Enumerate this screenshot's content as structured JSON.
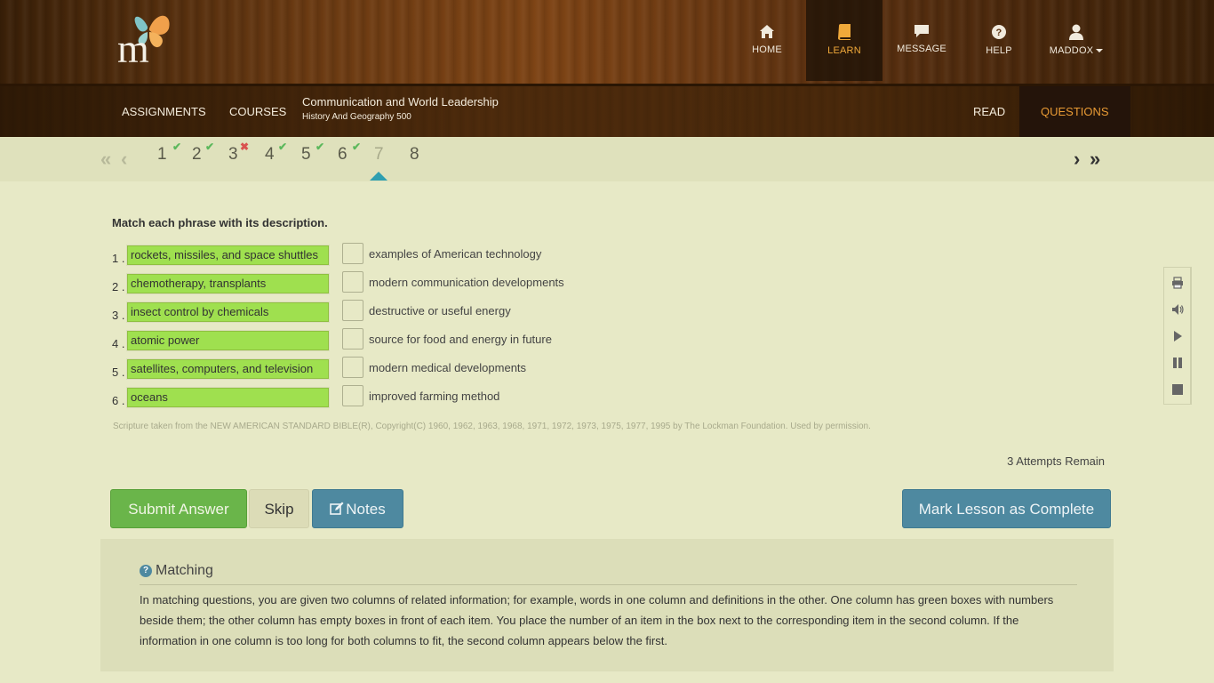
{
  "colors": {
    "accent_orange": "#e89a34",
    "correct_green": "#5cb85c",
    "wrong_red": "#d9534f",
    "phrase_green": "#9fe04f",
    "teal_button": "#4e89a0",
    "submit_green": "#6ab54a"
  },
  "header": {
    "nav": [
      {
        "label": "HOME",
        "icon": "home-icon"
      },
      {
        "label": "LEARN",
        "icon": "book-icon"
      },
      {
        "label": "MESSAGE",
        "icon": "message-icon"
      },
      {
        "label": "HELP",
        "icon": "help-icon"
      },
      {
        "label": "MADDOX",
        "icon": "user-icon"
      }
    ]
  },
  "subnav": {
    "assignments": "ASSIGNMENTS",
    "courses": "COURSES",
    "course_title": "Communication and World Leadership",
    "course_subtitle": "History And Geography 500",
    "read": "READ",
    "questions": "QUESTIONS"
  },
  "pager": {
    "pages": [
      {
        "label": "1",
        "status": "correct"
      },
      {
        "label": "2",
        "status": "correct"
      },
      {
        "label": "3",
        "status": "incorrect"
      },
      {
        "label": "4",
        "status": "correct"
      },
      {
        "label": "5",
        "status": "correct"
      },
      {
        "label": "6",
        "status": "correct"
      },
      {
        "label": "7",
        "status": "current"
      },
      {
        "label": "8",
        "status": "none"
      }
    ],
    "check_mark": "✔",
    "cross_mark": "✖"
  },
  "question": {
    "prompt": "Match each phrase with its description.",
    "items": [
      {
        "num": "1 .",
        "phrase": "rockets, missiles, and space shuttles",
        "answer": "",
        "description": "examples of American technology"
      },
      {
        "num": "2 .",
        "phrase": "chemotherapy, transplants",
        "answer": "",
        "description": "modern communication developments"
      },
      {
        "num": "3 .",
        "phrase": "insect control by chemicals",
        "answer": "",
        "description": "destructive or useful energy"
      },
      {
        "num": "4 .",
        "phrase": "atomic power",
        "answer": "",
        "description": "source for food and energy in future"
      },
      {
        "num": "5 .",
        "phrase": "satellites, computers, and television",
        "answer": "",
        "description": "modern medical developments"
      },
      {
        "num": "6 .",
        "phrase": "oceans",
        "answer": "",
        "description": "improved farming method"
      }
    ],
    "copyright": "Scripture taken from the NEW AMERICAN STANDARD BIBLE(R), Copyright(C) 1960, 1962, 1963, 1968, 1971, 1972, 1973, 1975, 1977, 1995 by The Lockman Foundation. Used by permission.",
    "attempts": "3 Attempts Remain"
  },
  "buttons": {
    "submit": "Submit Answer",
    "skip": "Skip",
    "notes": "Notes",
    "complete": "Mark Lesson as Complete"
  },
  "help": {
    "title": "Matching",
    "text": "In matching questions, you are given two columns of related information; for example, words in one column and definitions in the other. One column has green boxes with numbers beside them; the other column has empty boxes in front of each item. You place the number of an item in the box next to the corresponding item in the second column. If the information in one column is too long for both columns to fit, the second column appears below the first."
  },
  "side_tools": [
    "print-icon",
    "volume-icon",
    "play-icon",
    "pause-icon",
    "stop-icon"
  ]
}
